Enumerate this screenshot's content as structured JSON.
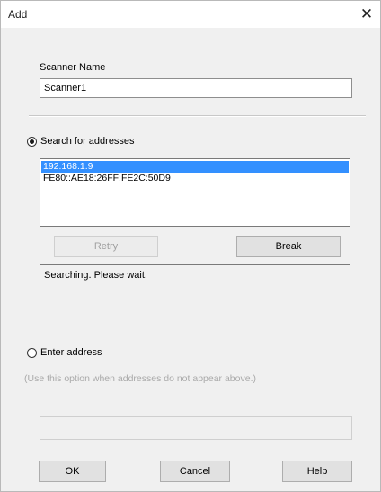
{
  "window": {
    "title": "Add",
    "close_glyph": "✕"
  },
  "scanner_name": {
    "label": "Scanner Name",
    "value": "Scanner1"
  },
  "search": {
    "label": "Search for addresses",
    "selected": true,
    "addresses": [
      "192.168.1.9",
      "FE80::AE18:26FF:FE2C:50D9"
    ],
    "selected_index": 0
  },
  "buttons": {
    "retry": "Retry",
    "break": "Break",
    "ok": "OK",
    "cancel": "Cancel",
    "help": "Help"
  },
  "status": {
    "text": "Searching. Please wait."
  },
  "enter_address": {
    "label": "Enter address",
    "selected": false,
    "hint": "(Use this option when addresses do not appear above.)",
    "value": ""
  },
  "colors": {
    "selection": "#3390ff",
    "disabled_text": "#a0a0a0",
    "dialog_bg": "#f0f0f0"
  }
}
